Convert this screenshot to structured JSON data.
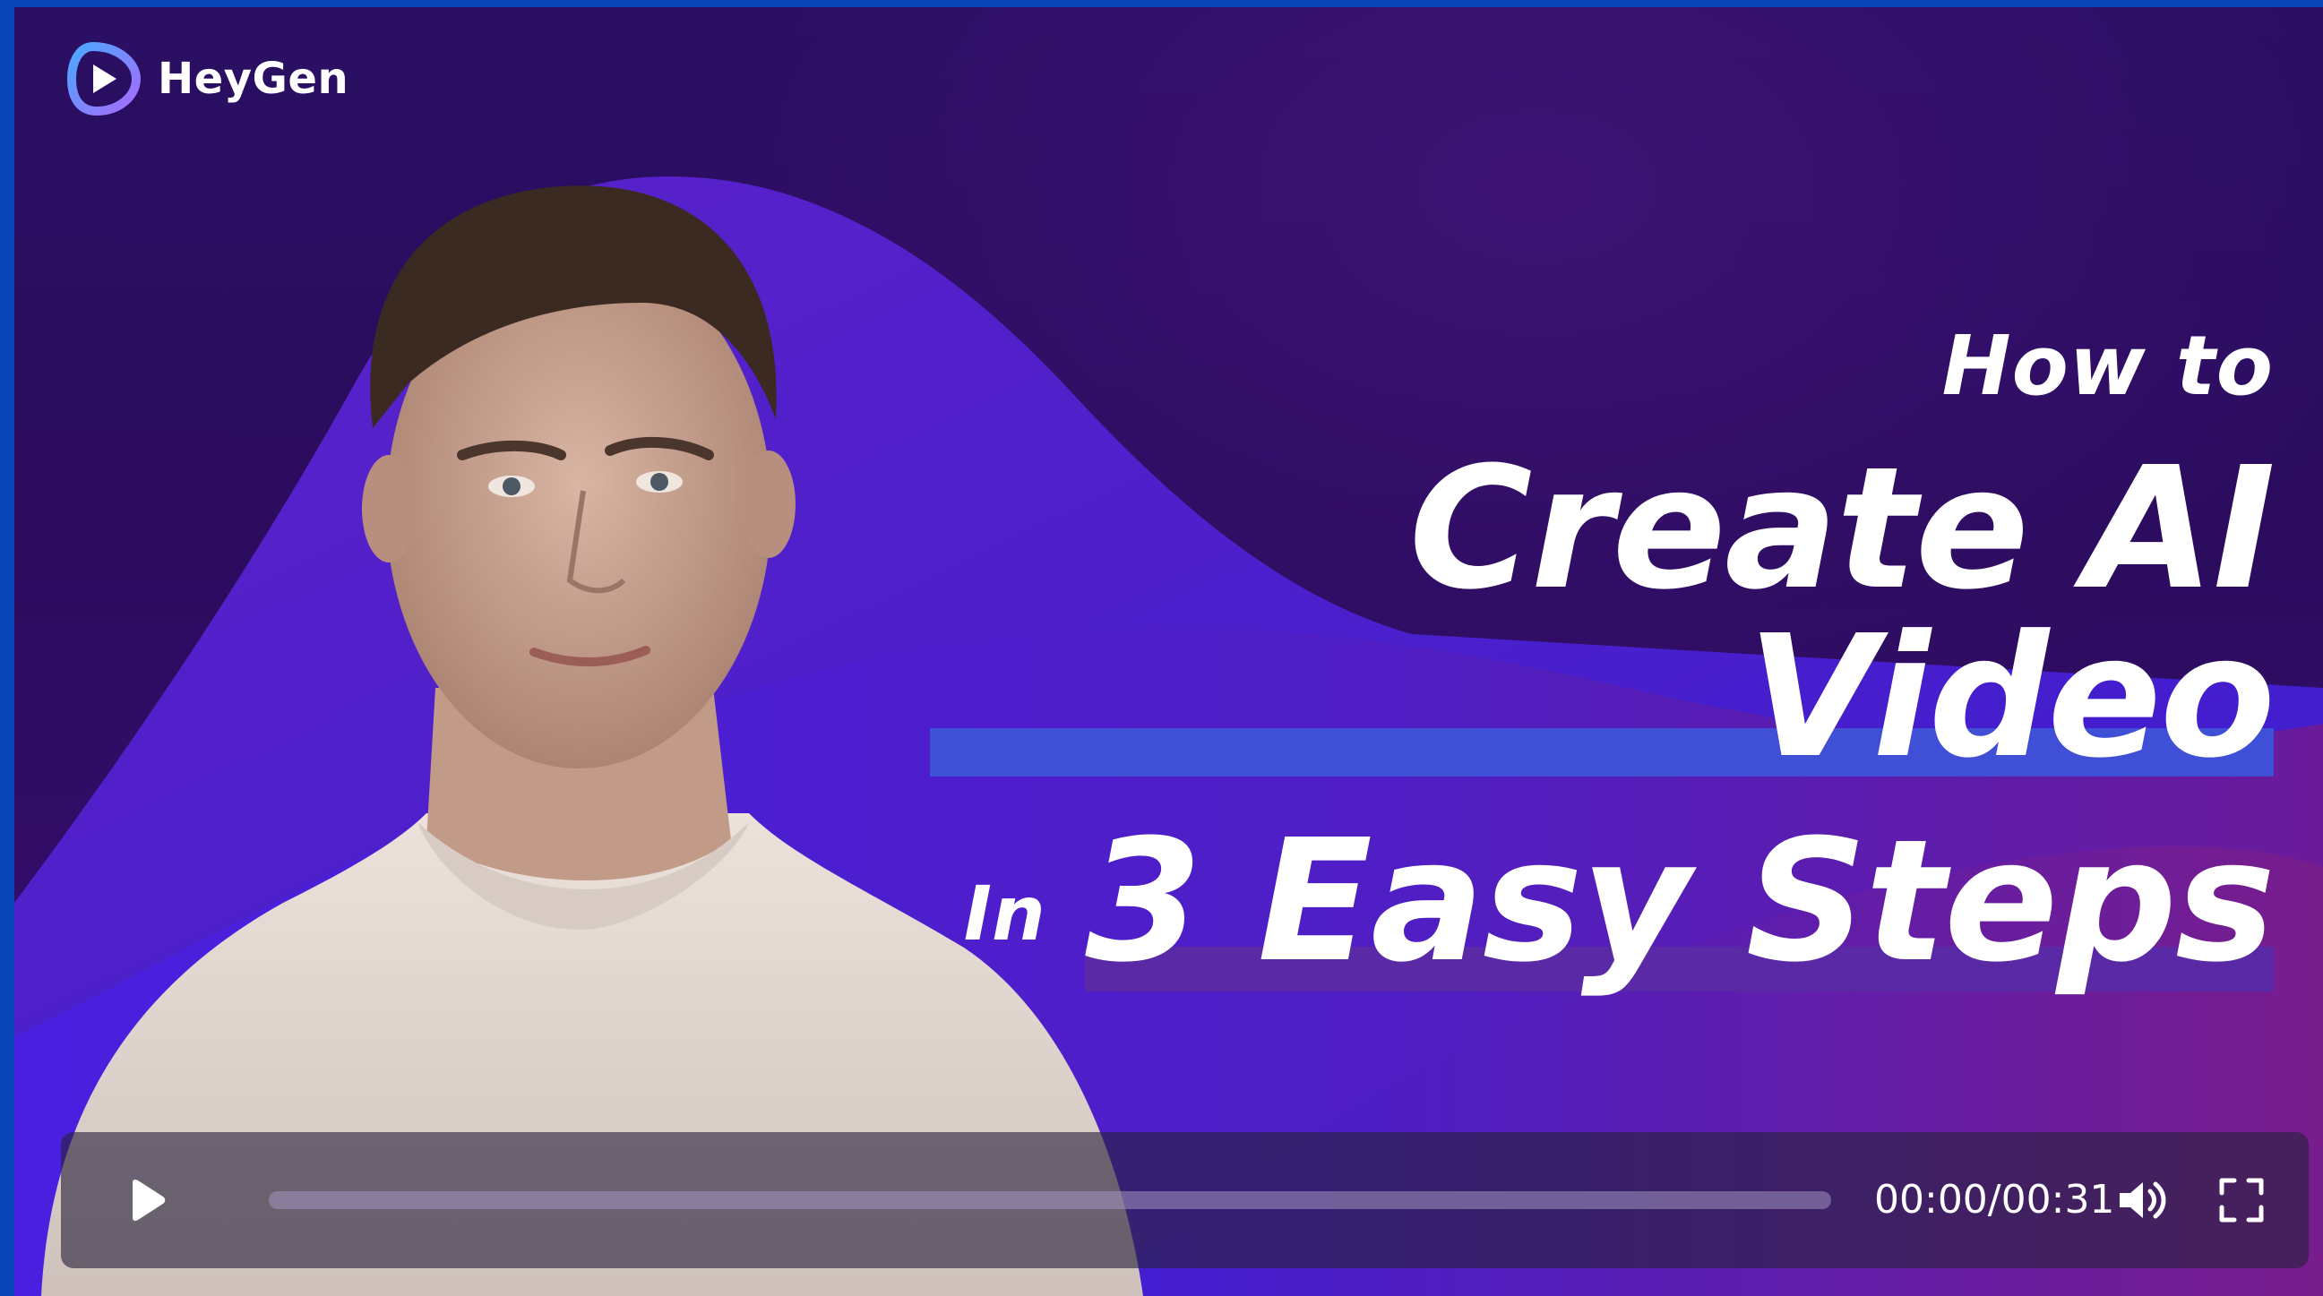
{
  "brand": {
    "name": "HeyGen",
    "logo_icon": "heygen-play-logo-icon"
  },
  "headline": {
    "line1": "How to",
    "line2": "Create AI Video",
    "line3_prefix": "In",
    "line3": "3 Easy Steps"
  },
  "player": {
    "play_icon": "play-icon",
    "current_time": "00:00",
    "duration": "00:31",
    "time_display": "00:00/00:31",
    "progress_fraction": 0,
    "volume_icon": "volume-icon",
    "fullscreen_icon": "fullscreen-icon"
  },
  "colors": {
    "background_dark": "#2a0f63",
    "wave_violet": "#4b1fd6",
    "accent_blue_highlight": "#3f4fd6",
    "accent_purple_highlight": "#5a2aa6",
    "text": "#ffffff"
  }
}
